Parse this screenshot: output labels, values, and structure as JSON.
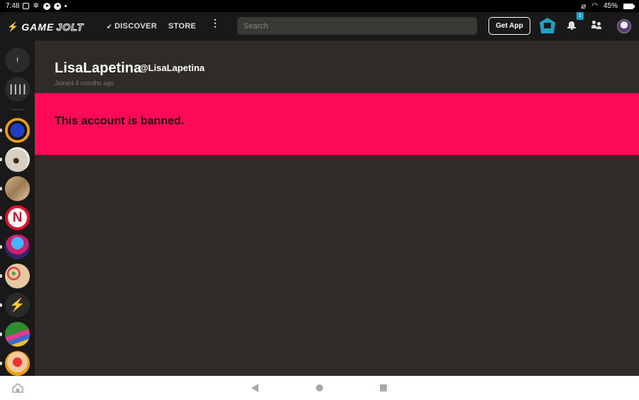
{
  "status_bar": {
    "time": "7:48",
    "battery": "45%",
    "icons": [
      "gallery-icon",
      "settings-icon",
      "play-icon",
      "play-icon",
      "dot-icon",
      "no-sim-icon",
      "wifi-icon",
      "battery-icon"
    ]
  },
  "nav": {
    "logo_game": "GAME",
    "logo_jolt": "JOLT",
    "discover": "DISCOVER",
    "store": "STORE",
    "more": "⋮",
    "search_placeholder": "Search",
    "get_app": "Get App",
    "notification_count": "1"
  },
  "profile": {
    "display_name": "LisaLapetina",
    "username": "@LisaLapetina",
    "joined": "Joined 4 months ago"
  },
  "banner": {
    "message": "This account is banned.",
    "color": "#ff0a56"
  },
  "sidebar": {
    "games": [
      {
        "name": "game-avatar-sonic"
      },
      {
        "name": "game-avatar-dog"
      },
      {
        "name": "game-avatar-bread"
      },
      {
        "name": "game-avatar-n-logo"
      },
      {
        "name": "game-avatar-fnf"
      },
      {
        "name": "game-avatar-palette"
      },
      {
        "name": "game-avatar-gamejolt"
      },
      {
        "name": "game-avatar-pepe"
      },
      {
        "name": "game-avatar-mario"
      }
    ]
  },
  "colors": {
    "accent": "#1fa2c9",
    "background": "#2f2c28",
    "nav": "#191919"
  }
}
